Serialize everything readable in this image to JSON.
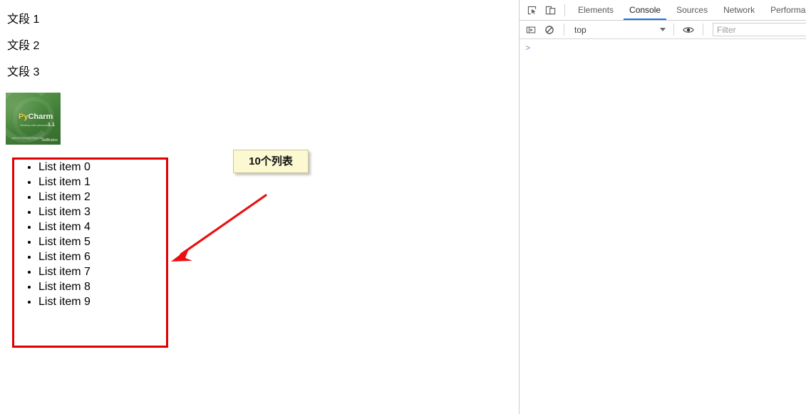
{
  "page": {
    "paragraphs": [
      {
        "text": "文段 1"
      },
      {
        "text": "文段 2"
      },
      {
        "text": "文段 3"
      }
    ],
    "image": {
      "alt": "PyCharm splash image",
      "brand_py": "Py",
      "brand_charm": "Charm",
      "tagline": "Develop with pleasure!",
      "version": "1.1",
      "footer_line": "JetBrains PyCharm Python IDE",
      "vendor": "JetBrains",
      "colors": {
        "background": "#4f8d41",
        "brand": "#f2d24a"
      }
    },
    "list": {
      "items": [
        "List item 0",
        "List item 1",
        "List item 2",
        "List item 3",
        "List item 4",
        "List item 5",
        "List item 6",
        "List item 7",
        "List item 8",
        "List item 9"
      ]
    },
    "annotations": {
      "box_color": "#e00000",
      "arrow_color": "#e81010",
      "callout": {
        "text": "10个列表",
        "background": "#fbf8d2",
        "border": "#c9c79a"
      }
    }
  },
  "devtools": {
    "toolbar_icons": [
      {
        "name": "inspect-element-icon",
        "title": "Inspect element"
      },
      {
        "name": "device-toolbar-icon",
        "title": "Toggle device toolbar"
      }
    ],
    "tabs": [
      {
        "label": "Elements",
        "active": false
      },
      {
        "label": "Console",
        "active": true
      },
      {
        "label": "Sources",
        "active": false
      },
      {
        "label": "Network",
        "active": false
      },
      {
        "label": "Performan",
        "active": false
      }
    ],
    "active_tab": "Console",
    "active_tab_color": "#1a73e8",
    "console_toolbar": {
      "sidebar_icon": "console-sidebar-icon",
      "clear_icon": "clear-console-icon",
      "context_value": "top",
      "context_caret": "chevron-down-icon",
      "eye_icon": "live-expression-icon",
      "filter_placeholder": "Filter",
      "filter_value": ""
    },
    "console": {
      "prompt": ">",
      "messages": []
    }
  }
}
